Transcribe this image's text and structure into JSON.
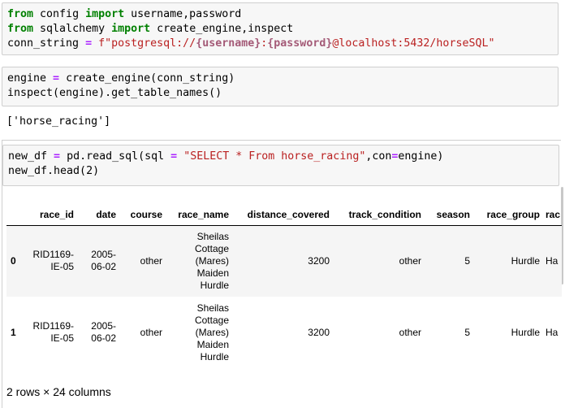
{
  "cells": {
    "c1": {
      "line1": {
        "kw1": "from",
        "a": " config ",
        "kw2": "import",
        "b": " username,password"
      },
      "line2": {
        "kw1": "from",
        "a": " sqlalchemy ",
        "kw2": "import",
        "b": " create_engine,inspect"
      },
      "line3": {
        "a": "conn_string ",
        "op": "=",
        "b": " ",
        "s1": "f\"postgresql://",
        "c": "{username}",
        "s2": ":",
        "d": "{password}",
        "s3": "@localhost:5432/horseSQL\""
      }
    },
    "c2": {
      "line1": {
        "a": "engine ",
        "op": "=",
        "b": " create_engine(conn_string)"
      },
      "line2": "inspect(engine).get_table_names()"
    },
    "c2_output": "['horse_racing']",
    "c3": {
      "line1": {
        "a": "new_df ",
        "op1": "=",
        "b": " pd.read_sql(sql ",
        "op2": "=",
        "c": " ",
        "s": "\"SELECT * From horse_racing\"",
        "d": ",con",
        "op3": "=",
        "e": "engine)"
      },
      "line2": "new_df.head(2)"
    }
  },
  "table": {
    "columns": [
      "",
      "race_id",
      "date",
      "course",
      "race_name",
      "distance_covered",
      "track_condition",
      "season",
      "race_group",
      "rac"
    ],
    "rows": [
      {
        "index": "0",
        "race_id": "RID1169-IE-05",
        "date": "2005-06-02",
        "course": "other",
        "race_name": "Sheilas Cottage (Mares) Maiden Hurdle",
        "distance_covered": "3200",
        "track_condition": "other",
        "season": "5",
        "race_group": "Hurdle",
        "rac": "Ha"
      },
      {
        "index": "1",
        "race_id": "RID1169-IE-05",
        "date": "2005-06-02",
        "course": "other",
        "race_name": "Sheilas Cottage (Mares) Maiden Hurdle",
        "distance_covered": "3200",
        "track_condition": "other",
        "season": "5",
        "race_group": "Hurdle",
        "rac": "Ha"
      }
    ]
  },
  "shape_text": "2 rows × 24 columns"
}
